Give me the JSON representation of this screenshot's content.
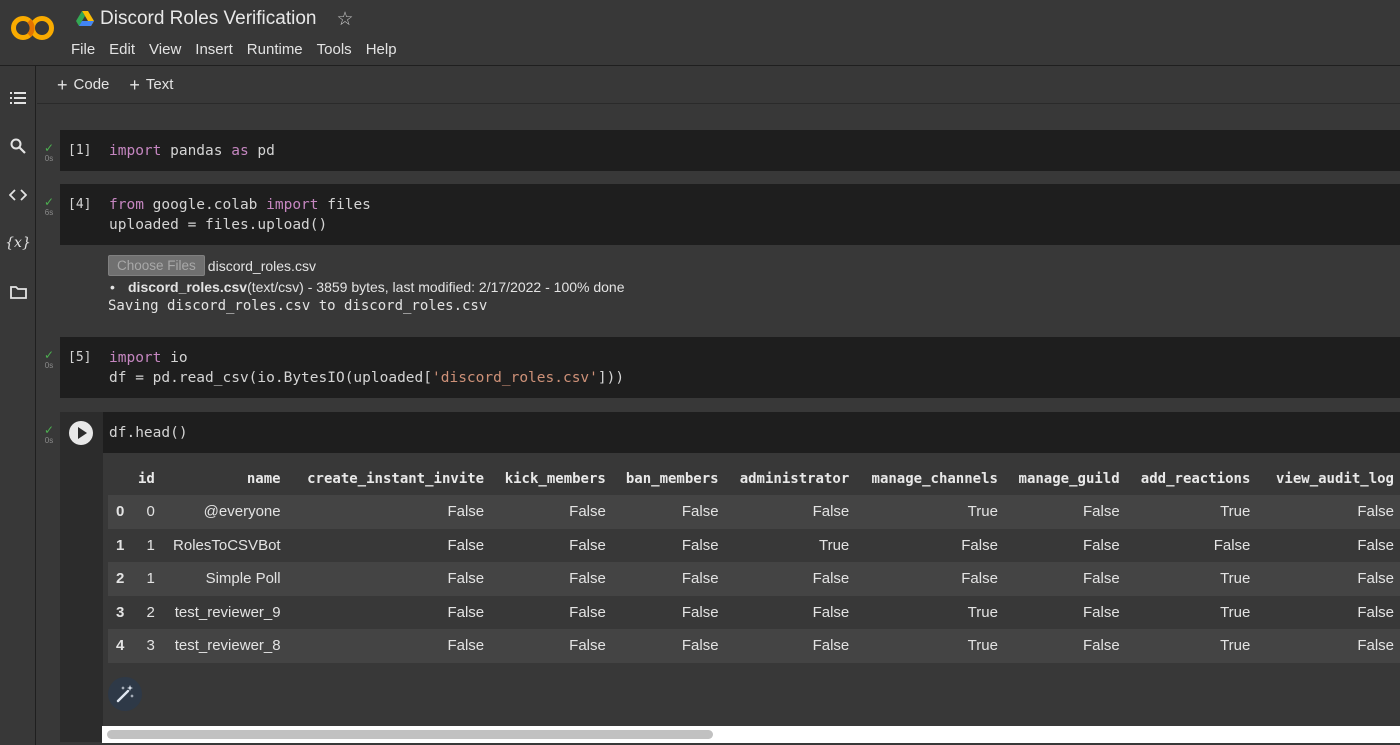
{
  "app": {
    "title": "Discord Roles Verification",
    "logo_text": "CO",
    "brand_color": "#f9ab00"
  },
  "menu": [
    "File",
    "Edit",
    "View",
    "Insert",
    "Runtime",
    "Tools",
    "Help"
  ],
  "rail_icons": [
    "table-of-contents-icon",
    "search-icon",
    "code-snippets-icon",
    "variables-icon",
    "files-folder-icon"
  ],
  "rail_variables_label": "{x}",
  "toolbar": {
    "add_code": "Code",
    "add_text": "Text"
  },
  "cells": [
    {
      "prompt": "[1]",
      "time": "0s",
      "lines": [
        [
          "import",
          " pandas ",
          "as",
          " pd"
        ]
      ]
    },
    {
      "prompt": "[4]",
      "time": "6s"
    },
    {
      "prompt": "[5]",
      "time": "0s"
    },
    {
      "prompt": "",
      "time": "0s",
      "code": "df.head()"
    }
  ],
  "cell4": {
    "line1_kw1": "from",
    "line1_mid": " google.colab ",
    "line1_kw2": "import",
    "line1_end": " files",
    "line2": "uploaded = files.upload()"
  },
  "cell1": {
    "kw1": "import",
    "mid": " pandas ",
    "kw2": "as",
    "end": " pd"
  },
  "cell5": {
    "line1_kw": "import",
    "line1_end": " io",
    "line2_start": "df = pd.read_csv(io.BytesIO(uploaded[",
    "line2_str": "'discord_roles.csv'",
    "line2_end": "]))"
  },
  "upload_output": {
    "choose_label": "Choose Files",
    "chosen_file": "discord_roles.csv",
    "file_bold": "discord_roles.csv",
    "file_detail": "(text/csv) - 3859 bytes, last modified: 2/17/2022 - 100% done",
    "saving": "Saving discord_roles.csv to discord_roles.csv"
  },
  "table": {
    "columns": [
      "",
      "id",
      "name",
      "create_instant_invite",
      "kick_members",
      "ban_members",
      "administrator",
      "manage_channels",
      "manage_guild",
      "add_reactions",
      "view_audit_log"
    ],
    "rows": [
      [
        "0",
        "0",
        "@everyone",
        "False",
        "False",
        "False",
        "False",
        "True",
        "False",
        "True",
        "False"
      ],
      [
        "1",
        "1",
        "RolesToCSVBot",
        "False",
        "False",
        "False",
        "True",
        "False",
        "False",
        "False",
        "False"
      ],
      [
        "2",
        "1",
        "Simple Poll",
        "False",
        "False",
        "False",
        "False",
        "False",
        "False",
        "True",
        "False"
      ],
      [
        "3",
        "2",
        "test_reviewer_9",
        "False",
        "False",
        "False",
        "False",
        "True",
        "False",
        "True",
        "False"
      ],
      [
        "4",
        "3",
        "test_reviewer_8",
        "False",
        "False",
        "False",
        "False",
        "True",
        "False",
        "True",
        "False"
      ]
    ]
  }
}
